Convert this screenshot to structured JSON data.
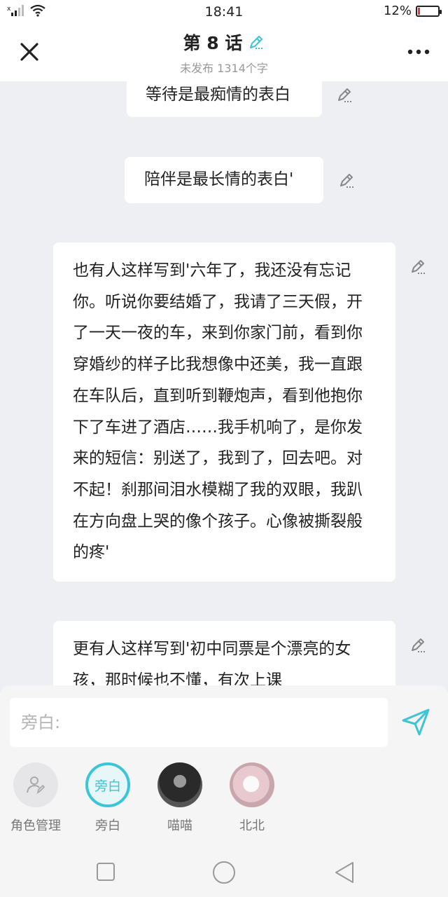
{
  "status": {
    "time": "18:41",
    "battery": "12%",
    "battery_level": 0.12
  },
  "header": {
    "title": "第 8 话",
    "subtitle": "未发布 1314个字"
  },
  "messages": [
    {
      "text": "等待是最痴情的表白"
    },
    {
      "text": "陪伴是最长情的表白'"
    },
    {
      "text": "也有人这样写到'六年了，我还没有忘记你。听说你要结婚了，我请了三天假，开了一天一夜的车，来到你家门前，看到你穿婚纱的样子比我想像中还美，我一直跟在车队后，直到听到鞭炮声，看到他抱你下了车进了酒店……我手机响了，是你发来的短信：别送了，我到了，回去吧。对不起！刹那间泪水模糊了我的双眼，我趴在方向盘上哭的像个孩子。心像被撕裂般的疼'"
    },
    {
      "text": "更有人这样写到'初中同票是个漂亮的女孩，那时候也不懂，有次上课"
    }
  ],
  "input": {
    "placeholder": "旁白:"
  },
  "roles": [
    {
      "label": "角色管理"
    },
    {
      "label": "旁白",
      "avatar_text": "旁白"
    },
    {
      "label": "喵喵"
    },
    {
      "label": "北北"
    }
  ],
  "colors": {
    "accent": "#3cc5d6",
    "battery_low": "#e53935"
  },
  "icons": {
    "close": "close-icon",
    "more": "more-icon",
    "edit": "pencil-icon",
    "send": "send-icon",
    "role_manage": "user-edit-icon",
    "nav_recent": "square-icon",
    "nav_home": "circle-icon",
    "nav_back": "triangle-back-icon"
  }
}
